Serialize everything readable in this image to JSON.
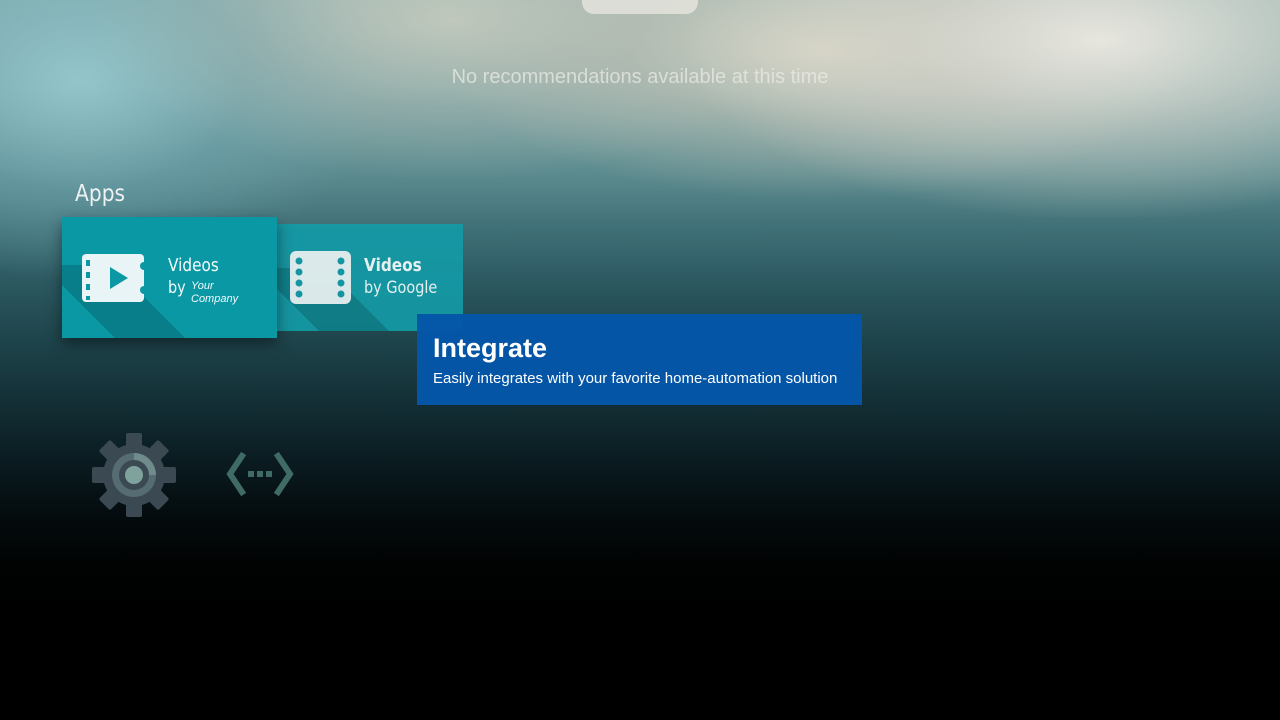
{
  "header": {
    "no_recommendations": "No recommendations available at this time"
  },
  "apps_row": {
    "title": "Apps",
    "tiles": [
      {
        "title": "Videos",
        "subtitle_by": "by",
        "subtitle_company": "Your Company",
        "icon": "video-play-ticket-icon"
      },
      {
        "title": "Videos",
        "subtitle": "by Google",
        "icon": "film-strip-icon"
      }
    ]
  },
  "tooltip": {
    "title": "Integrate",
    "description": "Easily integrates with your favorite home-automation solution"
  },
  "bottom_icons": [
    {
      "icon": "settings-gear-icon"
    },
    {
      "icon": "network-connection-icon"
    }
  ],
  "colors": {
    "tile_teal": "#0b98a5",
    "tooltip_blue": "#0556a8",
    "gear_gray": "#3b4a52"
  }
}
